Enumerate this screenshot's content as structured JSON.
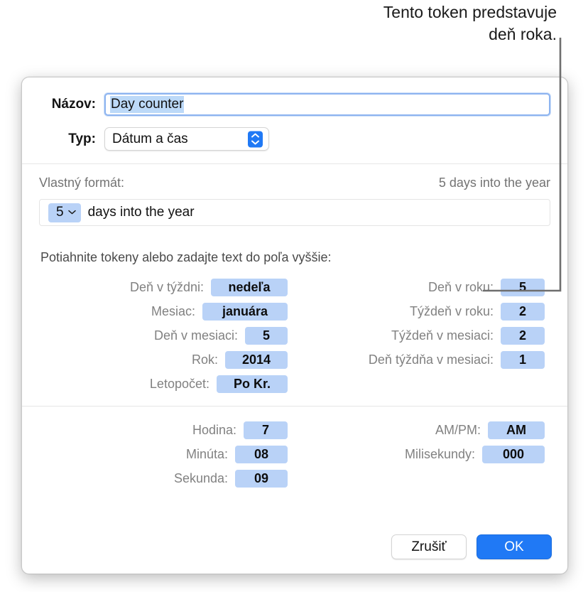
{
  "annotation": {
    "text_line1": "Tento token predstavuje",
    "text_line2": "deň roka.",
    "line_color": "#6e6e6e"
  },
  "dialog": {
    "name_field": {
      "label": "Názov:",
      "value": "Day counter",
      "placeholder": "Názov"
    },
    "type_field": {
      "label": "Typ:",
      "value": "Dátum a čas",
      "chevron_icon": "chevron-up-down-icon"
    },
    "format_section": {
      "label": "Vlastný formát:",
      "preview": "5 days into the year",
      "token": {
        "text": "5",
        "chevron_icon": "chevron-down-icon"
      },
      "literal_text": "days into the year"
    },
    "tokens_section": {
      "hint": "Potiahnite tokeny alebo zadajte text do poľa vyššie:",
      "left_column": [
        {
          "label": "Deň v týždni:",
          "value": "nedeľa",
          "width_class": "w-nedela"
        },
        {
          "label": "Mesiac:",
          "value": "januára",
          "width_class": "w-januara"
        },
        {
          "label": "Deň v mesiaci:",
          "value": "5",
          "width_class": "w-5"
        },
        {
          "label": "Rok:",
          "value": "2014",
          "width_class": "w-2014"
        },
        {
          "label": "Letopočet:",
          "value": "Po Kr.",
          "width_class": "w-pokr"
        }
      ],
      "right_column": [
        {
          "label": "Deň v roku:",
          "value": "5",
          "width_class": "w-num"
        },
        {
          "label": "Týždeň v roku:",
          "value": "2",
          "width_class": "w-num"
        },
        {
          "label": "Týždeň v mesiaci:",
          "value": "2",
          "width_class": "w-num"
        },
        {
          "label": "Deň týždňa v mesiaci:",
          "value": "1",
          "width_class": "w-num"
        }
      ]
    },
    "time_section": {
      "left_column": [
        {
          "label": "Hodina:",
          "value": "7",
          "width_class": "w-hour"
        },
        {
          "label": "Minúta:",
          "value": "08",
          "width_class": "w-min"
        },
        {
          "label": "Sekunda:",
          "value": "09",
          "width_class": "w-sec"
        }
      ],
      "right_column": [
        {
          "label": "AM/PM:",
          "value": "AM",
          "width_class": "w-ampm"
        },
        {
          "label": "Milisekundy:",
          "value": "000",
          "width_class": "w-ms"
        }
      ]
    },
    "buttons": {
      "cancel": "Zrušiť",
      "ok": "OK"
    }
  },
  "colors": {
    "token_blue": "#b9d2f7",
    "accent_blue": "#2079f5",
    "selection_blue": "#bcd9f8",
    "focus_ring": "#8db4f0"
  }
}
